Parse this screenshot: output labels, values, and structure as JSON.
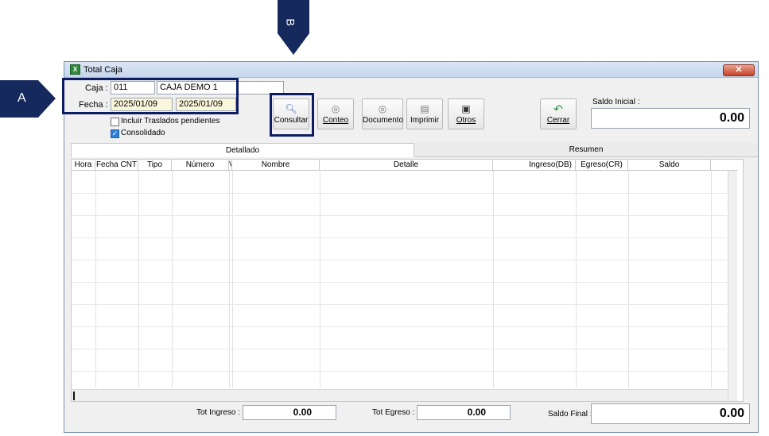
{
  "callouts": {
    "a": "A",
    "b": "B"
  },
  "window": {
    "title": "Total Caja",
    "close_glyph": "✕",
    "app_icon": "excel-like-icon"
  },
  "form": {
    "caja_label": "Caja :",
    "caja_code": "011",
    "caja_name": "CAJA DEMO 1",
    "fecha_label": "Fecha :",
    "fecha_from": "2025/01/09",
    "fecha_to": "2025/01/09",
    "incluir_label": "Incluir Traslados pendientes",
    "incluir_checked": false,
    "consolidado_label": "Consolidado",
    "consolidado_checked": true
  },
  "toolbar": {
    "consultar": "Consultar",
    "conteo": "Conteo",
    "documento": "Documento",
    "imprimir": "Imprimir",
    "otros": "Otros",
    "cerrar": "Cerrar"
  },
  "saldo_inicial": {
    "label": "Saldo Inicial :",
    "value": "0.00"
  },
  "tabs": [
    "Detallado",
    "Resumen"
  ],
  "grid": {
    "columns": [
      "Hora",
      "Fecha CNT",
      "Tipo",
      "Número",
      "V",
      "Nombre",
      "Detalle",
      "Ingreso(DB)",
      "Egreso(CR)",
      "Saldo"
    ]
  },
  "totals": {
    "tot_ingreso_label": "Tot Ingreso :",
    "tot_ingreso": "0.00",
    "tot_egreso_label": "Tot Egreso :",
    "tot_egreso": "0.00",
    "saldo_final_label": "Saldo Final :",
    "saldo_final": "0.00"
  },
  "colors": {
    "accent": "#16295c",
    "highlight": "#0e1d63",
    "date_bg": "#fbf7dc"
  }
}
